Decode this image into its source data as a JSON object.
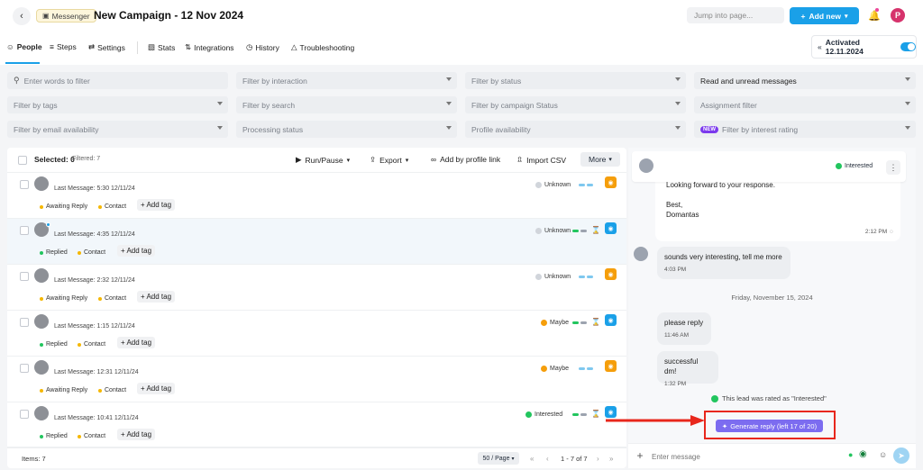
{
  "header": {
    "back_icon": "arrow-left-icon",
    "channel": "Messenger",
    "title": "New Campaign - 12 Nov 2024",
    "jump_placeholder": "Jump into page...",
    "add_new": "Add new",
    "profile_initial": "P",
    "accent": "#1aa0e8"
  },
  "tabs": [
    {
      "label": "People",
      "icon": "people-icon"
    },
    {
      "label": "Steps",
      "icon": "steps-icon"
    },
    {
      "label": "Settings",
      "icon": "settings-icon"
    },
    {
      "label": "Stats",
      "icon": "stats-icon"
    },
    {
      "label": "Integrations",
      "icon": "integrations-icon"
    },
    {
      "label": "History",
      "icon": "history-icon"
    },
    {
      "label": "Troubleshooting",
      "icon": "warning-icon"
    }
  ],
  "activated": {
    "label": "Activated 12.11.2024"
  },
  "filters": {
    "words": "Enter words to filter",
    "interaction": "Filter by interaction",
    "status": "Filter by status",
    "read": "Read and unread messages",
    "tags": "Filter by tags",
    "search": "Filter by search",
    "campaign_status": "Filter by campaign Status",
    "assignment": "Assignment filter",
    "email": "Filter by email availability",
    "processing": "Processing status",
    "profile": "Profile availability",
    "interest_badge": "NEW",
    "interest": "Filter by interest rating"
  },
  "toolbar": {
    "selected": "Selected: 0",
    "filtered": "Filtered: 7",
    "run_pause": "Run/Pause",
    "export": "Export",
    "add_by_link": "Add by profile link",
    "import_csv": "Import CSV",
    "more": "More"
  },
  "rows": [
    {
      "last_message": "Last Message: 5:30 12/11/24",
      "tag1": "Awaiting Reply",
      "tag1_color": "#f5b700",
      "tag2": "Contact",
      "tag2_color": "#f5b700",
      "add_tag": "+ Add tag",
      "status": "Unknown",
      "status_color": "#d1d5db",
      "action": "orange"
    },
    {
      "last_message": "Last Message: 4:35 12/11/24",
      "tag1": "Replied",
      "tag1_color": "#22c55e",
      "tag2": "Contact",
      "tag2_color": "#f5b700",
      "add_tag": "+ Add tag",
      "status": "Unknown",
      "status_color": "#d1d5db",
      "action": "blue"
    },
    {
      "last_message": "Last Message: 2:32 12/11/24",
      "tag1": "Awaiting Reply",
      "tag1_color": "#f5b700",
      "tag2": "Contact",
      "tag2_color": "#f5b700",
      "add_tag": "+ Add tag",
      "status": "Unknown",
      "status_color": "#d1d5db",
      "action": "orange"
    },
    {
      "last_message": "Last Message: 1:15 12/11/24",
      "tag1": "Replied",
      "tag1_color": "#22c55e",
      "tag2": "Contact",
      "tag2_color": "#f5b700",
      "add_tag": "+ Add tag",
      "status": "Maybe",
      "status_color": "#f59e0b",
      "action": "blue"
    },
    {
      "last_message": "Last Message: 12:31 12/11/24",
      "tag1": "Awaiting Reply",
      "tag1_color": "#f5b700",
      "tag2": "Contact",
      "tag2_color": "#f5b700",
      "add_tag": "+ Add tag",
      "status": "Maybe",
      "status_color": "#f59e0b",
      "action": "orange"
    },
    {
      "last_message": "Last Message: 10:41 12/11/24",
      "tag1": "Replied",
      "tag1_color": "#22c55e",
      "tag2": "Contact",
      "tag2_color": "#f5b700",
      "add_tag": "+ Add tag",
      "status": "Interested",
      "status_color": "#22c55e",
      "action": "blue"
    }
  ],
  "footer": {
    "items": "Items: 7",
    "per_page": "50 / Page",
    "range": "1 - 7 of 7"
  },
  "chat": {
    "head_status": "Interested",
    "outgoing": [
      "Looking forward to your response.",
      "Best,",
      "Domantas"
    ],
    "outgoing_time": "2:12 PM",
    "msg1": "sounds very interesting, tell me more",
    "msg1_time": "4:03 PM",
    "date_separator": "Friday, November 15, 2024",
    "msg2": "please reply",
    "msg2_time": "11:46 AM",
    "msg3": "successful dm!",
    "msg3_time": "1:32 PM",
    "rated": "This lead was rated as \"Interested\"",
    "generate_reply": "Generate reply (left 17 of 20)",
    "composer_placeholder": "Enter message"
  }
}
